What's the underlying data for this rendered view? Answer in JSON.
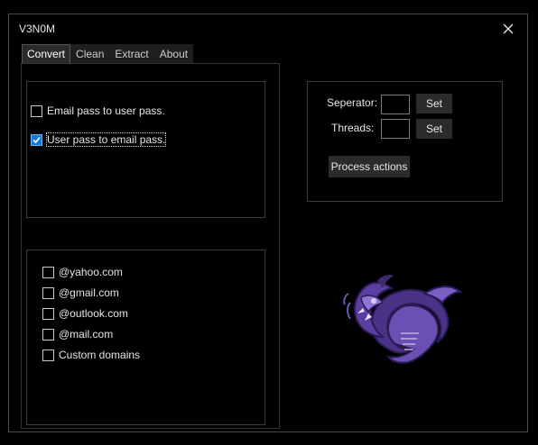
{
  "window": {
    "title": "V3N0M"
  },
  "tabs": [
    {
      "label": "Convert",
      "active": true
    },
    {
      "label": "Clean"
    },
    {
      "label": "Extract"
    },
    {
      "label": "About"
    }
  ],
  "convert": {
    "options": [
      {
        "label": "Email pass to user pass.",
        "checked": false
      },
      {
        "label": "User pass to email pass.",
        "checked": true
      }
    ],
    "domains": [
      {
        "label": "@yahoo.com",
        "checked": false
      },
      {
        "label": "@gmail.com",
        "checked": false
      },
      {
        "label": "@outlook.com",
        "checked": false
      },
      {
        "label": "@mail.com",
        "checked": false
      },
      {
        "label": "Custom domains",
        "checked": false
      }
    ]
  },
  "settings": {
    "separator_label": "Seperator:",
    "separator_value": "",
    "threads_label": "Threads:",
    "threads_value": "",
    "set_label": "Set",
    "process_label": "Process actions"
  },
  "colors": {
    "accent": "#1a77d4",
    "logo_purple": "#5b3fa0"
  },
  "icons": {
    "close": "close-icon",
    "check": "checkmark-icon",
    "logo": "venom-serpent-logo"
  }
}
